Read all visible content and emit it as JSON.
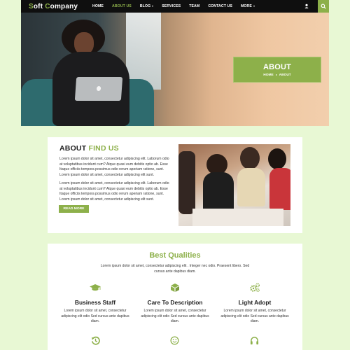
{
  "brand": {
    "name_accent": "S",
    "name_rest": "oft ",
    "name_accent2": "C",
    "name_rest2": "ompany"
  },
  "nav": [
    {
      "label": "HOME",
      "active": false,
      "dropdown": false
    },
    {
      "label": "ABOUT US",
      "active": true,
      "dropdown": false
    },
    {
      "label": "BLOG",
      "active": false,
      "dropdown": true
    },
    {
      "label": "SERVICES",
      "active": false,
      "dropdown": false
    },
    {
      "label": "TEAM",
      "active": false,
      "dropdown": false
    },
    {
      "label": "CONTACT US",
      "active": false,
      "dropdown": false
    },
    {
      "label": "MORE",
      "active": false,
      "dropdown": true
    }
  ],
  "icons": {
    "user": "user-icon",
    "search": "search-icon"
  },
  "hero": {
    "banner_title": "ABOUT",
    "crumb_home": "HOME",
    "crumb_current": "ABOUT"
  },
  "about": {
    "title_main": "ABOUT ",
    "title_accent": "FIND US",
    "para1": "Lorem ipsum dolor sit amet, consectetur adipiscing elit. Laborum odio at voluptatibus incidunt cum? Atque quasi eum debitis optio ab. Esse Itaque officiis tempora possimus odio rerum aperiam ratione, sunt. Lorem ipsum dolor sit amet, consectetur adipiscing elit sunt.",
    "para2": "Lorem ipsum dolor sit amet, consectetur adipiscing elit. Laborum odio at voluptatibus incidunt cum? Atque quasi eum debitis optio ab. Esse Itaque officiis tempora possimus odio rerum aperiam ratione, sunt. Lorem ipsum dolor sit amet, consectetur adipiscing elit sunt.",
    "read_more": "READ MORE"
  },
  "qualities": {
    "title": "Best Qualities",
    "subtitle": "Lorem ipsum dolor sit amet, consectetur adipiscing elit . Integer nec odio. Praesent libero. Sed cursus ante dapibus diam.",
    "features": [
      {
        "icon": "graduation-cap-icon",
        "name": "Business Staff",
        "desc": "Lorem ipsum dolor sit amet, consectetur adipiscing elit odio Sed cursus ante dapibus diam."
      },
      {
        "icon": "cube-icon",
        "name": "Care To Description",
        "desc": "Lorem ipsum dolor sit amet, consectetur adipiscing elit odio Sed cursus ante dapibus diam."
      },
      {
        "icon": "gears-icon",
        "name": "Light Adopt",
        "desc": "Lorem ipsum dolor sit amet, consectetur adipiscing elit odio Sed cursus ante dapibus diam."
      }
    ],
    "next_row_icons": [
      "history-icon",
      "smile-icon",
      "headphones-icon"
    ]
  },
  "colors": {
    "accent": "#8db04a",
    "nav_bg": "#0f0f0f",
    "page_bg": "#e8f8d4"
  }
}
